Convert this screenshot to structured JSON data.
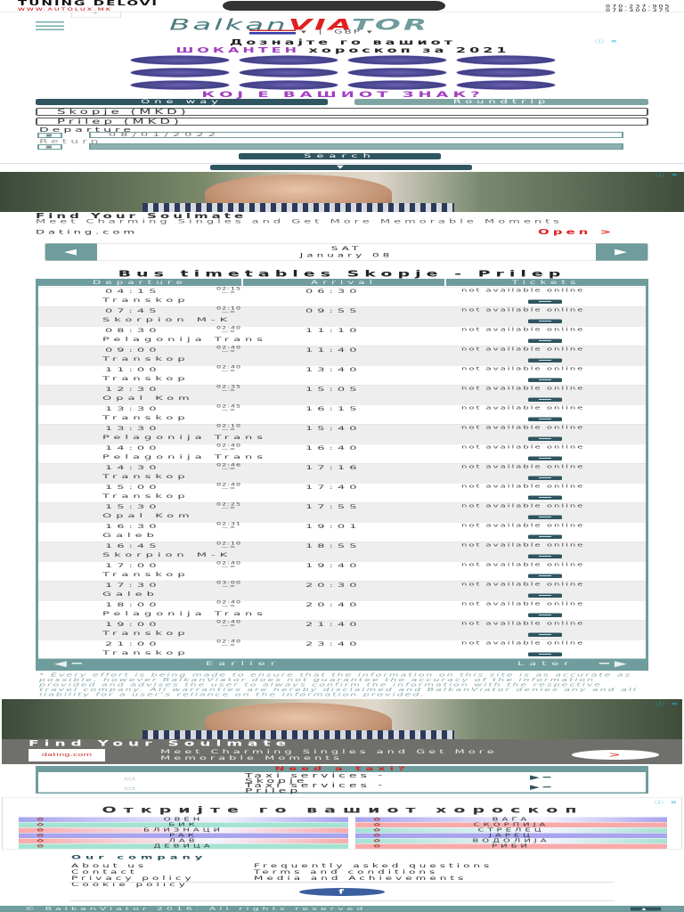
{
  "top_ad": {
    "title": "TUNING DELOVI",
    "url": "WWW.AUTOLUX.MK",
    "phones": [
      "070-237-905",
      "078-300-375"
    ]
  },
  "header": {
    "logo_part1": "Balkan",
    "logo_part2": "VIA",
    "logo_part3": "TOR",
    "currency": "GBP"
  },
  "horoscope_ad": {
    "line1": "Дознајте го вашиот",
    "line2_highlight": "ШОКАНТЕН",
    "line2_rest": "хороскоп за 2021",
    "cta": "КОЈ Е ВАШИОТ ЗНАК?"
  },
  "search": {
    "tab_oneway": "One way",
    "tab_roundtrip": "Roundtrip",
    "from": "Skopje (MKD)",
    "to": "Prilep (MKD)",
    "departure_label": "Departure",
    "departure_value": "08/01/2022",
    "return_label": "Return",
    "return_value": "",
    "search_button": "Search"
  },
  "ad1": {
    "title": "Find Your Soulmate",
    "desc": "Meet Charming Singles and Get More Memorable Moments",
    "brand": "Dating.com",
    "open": "Open  >"
  },
  "datenav": {
    "day": "SAT",
    "date": "January 08"
  },
  "page_title": "Bus timetables Skopje - Prilep",
  "table": {
    "headers": [
      "Departure",
      "Arrival",
      "Tickets"
    ],
    "na_text": "not available online",
    "rows": [
      {
        "dep": "04:15",
        "dur": "02:15",
        "arr": "06:30",
        "company": "Transkop"
      },
      {
        "dep": "07:45",
        "dur": "02:10",
        "arr": "09:55",
        "company": "Skorpion M-K"
      },
      {
        "dep": "08:30",
        "dur": "02:40",
        "arr": "11:10",
        "company": "Pelagonija Trans"
      },
      {
        "dep": "09:00",
        "dur": "02:40",
        "arr": "11:40",
        "company": "Transkop"
      },
      {
        "dep": "11:00",
        "dur": "02:40",
        "arr": "13:40",
        "company": "Transkop"
      },
      {
        "dep": "12:30",
        "dur": "02:35",
        "arr": "15:05",
        "company": "Opal Kom"
      },
      {
        "dep": "13:30",
        "dur": "02:45",
        "arr": "16:15",
        "company": "Transkop"
      },
      {
        "dep": "13:30",
        "dur": "02:10",
        "arr": "15:40",
        "company": "Pelagonija Trans"
      },
      {
        "dep": "14:00",
        "dur": "02:40",
        "arr": "16:40",
        "company": "Pelagonija Trans"
      },
      {
        "dep": "14:30",
        "dur": "02:46",
        "arr": "17:16",
        "company": "Transkop"
      },
      {
        "dep": "15:00",
        "dur": "02:40",
        "arr": "17:40",
        "company": "Transkop"
      },
      {
        "dep": "15:30",
        "dur": "02:25",
        "arr": "17:55",
        "company": "Opal Kom"
      },
      {
        "dep": "16:30",
        "dur": "02:31",
        "arr": "19:01",
        "company": "Galeb"
      },
      {
        "dep": "16:45",
        "dur": "02:10",
        "arr": "18:55",
        "company": "Skorpion M-K"
      },
      {
        "dep": "17:00",
        "dur": "02:40",
        "arr": "19:40",
        "company": "Transkop"
      },
      {
        "dep": "17:30",
        "dur": "03:00",
        "arr": "20:30",
        "company": "Galeb"
      },
      {
        "dep": "18:00",
        "dur": "02:40",
        "arr": "20:40",
        "company": "Pelagonija Trans"
      },
      {
        "dep": "19:00",
        "dur": "02:40",
        "arr": "21:40",
        "company": "Transkop"
      },
      {
        "dep": "21:00",
        "dur": "02:40",
        "arr": "23:40",
        "company": "Transkop"
      }
    ],
    "earlier": "Earlier",
    "later": "Later"
  },
  "disclaimer": "* Every effort is being made to ensure that the information on this site is as accurate as possible, however BalkanViator does not guarantee the accuracy of the information provided and advises the user to always confirm the information with the respective travel company. All warranties are hereby disclaimed and BalkanViator denies any and all liability for a user's reliance on the information provided.",
  "ad2": {
    "title": "Find Your Soulmate",
    "desc": "Meet Charming Singles and Get More Memorable Moments",
    "brand": "dating.com",
    "cta": ">"
  },
  "taxi": {
    "header": "Need a taxi?",
    "items": [
      "Taxi services - Skopje",
      "Taxi services - Prilep"
    ]
  },
  "horoscope_box": {
    "title": "Откријте го вашиот хороскоп",
    "left": [
      {
        "name": "ОВЕН",
        "color": "#a8a4ee"
      },
      {
        "name": "БИК",
        "color": "#a4e2d2"
      },
      {
        "name": "БЛИЗНАЦИ",
        "color": "#f8aaaa"
      },
      {
        "name": "РАК",
        "color": "#a8a4ee"
      },
      {
        "name": "ЛАВ",
        "color": "#f8aaaa"
      },
      {
        "name": "ДЕВИЦА",
        "color": "#a4e2d2"
      }
    ],
    "right": [
      {
        "name": "ВАГА",
        "color": "#a8a4ee"
      },
      {
        "name": "СКОРПИЈА",
        "color": "#f8aaaa"
      },
      {
        "name": "СТРЕЛЕЦ",
        "color": "#a4e2d2"
      },
      {
        "name": "ЈАРЕЦ",
        "color": "#a8a4ee"
      },
      {
        "name": "ВОДОЛИЈА",
        "color": "#a4e2d2"
      },
      {
        "name": "РИБИ",
        "color": "#f8aaaa"
      }
    ]
  },
  "footer": {
    "heading": "Our company",
    "links_col1": [
      "About us",
      "Contact",
      "Privacy policy",
      "Cookie policy"
    ],
    "links_col2": [
      "Frequently asked questions",
      "Terms and conditions",
      "Media and Achievements"
    ],
    "copyright": "© BalkanViator 2016. All rights reserved."
  }
}
